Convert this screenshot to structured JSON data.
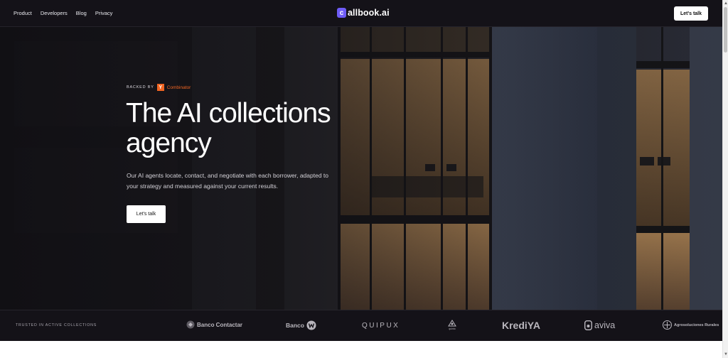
{
  "nav": {
    "links": [
      "Product",
      "Developers",
      "Blog",
      "Privacy"
    ],
    "brand_mark": "c",
    "brand_text": "allbook.ai",
    "cta": "Let's talk"
  },
  "hero": {
    "backed_label": "BACKED BY",
    "yc_mark": "Y",
    "yc_text": "Combinator",
    "headline": "The AI collections agency",
    "subtext": "Our AI agents locate, contact, and negotiate with each borrower, adapted to your strategy and measured against your current results.",
    "cta": "Let's talk"
  },
  "trusted": {
    "label": "TRUSTED IN ACTIVE COLLECTIONS",
    "logos": [
      "Banco Contactar",
      "Banco",
      "QUIPUX",
      "quinto",
      "KrediYA",
      "aviva",
      "Agrosoluciones Rurales"
    ]
  },
  "colors": {
    "brand_accent": "#6e5cf6",
    "yc_orange": "#f26522",
    "nav_bg": "#141218"
  },
  "icons": [
    "brand-logo-icon",
    "yc-logo-icon",
    "banco-contactar-icon",
    "banco-w-icon",
    "quinto-icon",
    "aviva-icon",
    "agro-icon"
  ]
}
